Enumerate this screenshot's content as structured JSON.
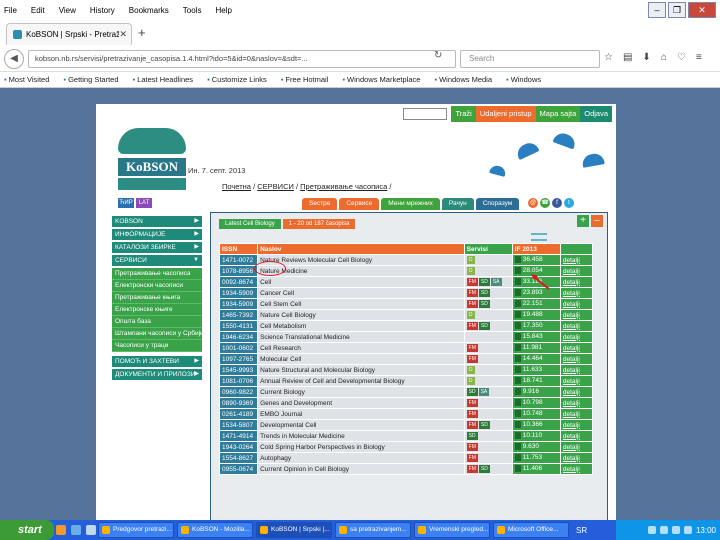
{
  "browser": {
    "menu": [
      "File",
      "Edit",
      "View",
      "History",
      "Bookmarks",
      "Tools",
      "Help"
    ],
    "window_controls": [
      "–",
      "❐",
      "✕"
    ],
    "tab_title": "KoBSON | Srpski - Pretraživanje",
    "url": "kobson.nb.rs/servisi/pretrazivanje_casopisa.1.4.html?ido=5&id=0&naslov=&sdt=...",
    "search_placeholder": "Search",
    "bookmarks": [
      "Most Visited",
      "Getting Started",
      "Latest Headlines",
      "Customize Links",
      "Free Hotmail",
      "Windows Marketplace",
      "Windows Media",
      "Windows"
    ]
  },
  "topnav": {
    "search_btn": "Traži",
    "remote": "Udaljeni pristup",
    "sitemap": "Mapa sajta",
    "logout": "Odjava"
  },
  "logo": {
    "name": "KoBSON"
  },
  "header": {
    "date": "Ин. 7. септ. 2013",
    "crumb_home": "Почетна",
    "crumb_services": "СЕРВИСИ",
    "crumb_current": "Претраживање часописа"
  },
  "langs": [
    "ЋИР",
    "LAT"
  ],
  "sidebar": {
    "items": [
      {
        "label": "KOBSON",
        "arrow": "▶"
      },
      {
        "label": "ИНФОРМАЦИЈЕ",
        "arrow": "▶"
      },
      {
        "label": "КАТАЛОЗИ ЗБИРКЕ",
        "arrow": "▶"
      },
      {
        "label": "СЕРВИСИ",
        "arrow": "▼"
      }
    ],
    "subitems": [
      "Претраживање часописа",
      "Електронски часописи",
      "Претраживање књига",
      "Електронске књиге",
      "Општа база",
      "Штампани часописи у Србији",
      "Часописи у траци"
    ],
    "bottom_items": [
      {
        "label": "ПОМОЋ И ЗАХТЕВИ",
        "arrow": "▶"
      },
      {
        "label": "ДОКУМЕНТИ И ПРИЛОЗИ",
        "arrow": "▶"
      }
    ]
  },
  "service_tabs": [
    "Ѕестре",
    "Сервисе",
    "Мени мрежних",
    "Рачун",
    "Споразум"
  ],
  "social": [
    "@",
    "☎",
    "f",
    "t"
  ],
  "panel": {
    "list_tabs": [
      "Latest Cell Biology",
      "1 - 20 od 187 časopisa"
    ],
    "buttons": [
      "+",
      "–"
    ]
  },
  "table": {
    "headers": [
      "ISSN",
      "Naslov",
      "Servisi",
      "IF 2013",
      ""
    ],
    "rows": [
      {
        "issn": "1471-0072",
        "title": "Nature Reviews Molecular Cell Biology",
        "services": [
          "O"
        ],
        "if": "36.458",
        "detail": "detalji"
      },
      {
        "issn": "1078-8956",
        "title": "Nature Medicine",
        "services": [
          "O"
        ],
        "if": "28.054",
        "detail": "detalji"
      },
      {
        "issn": "0092-8674",
        "title": "Cell",
        "services": [
          "FM",
          "SD",
          "SA"
        ],
        "if": "33.116",
        "detail": "detalji"
      },
      {
        "issn": "1934-5909",
        "title": "Cancer Cell",
        "services": [
          "FM",
          "SD"
        ],
        "if": "23.893",
        "detail": "detalji"
      },
      {
        "issn": "1934-5909",
        "title": "Cell Stem Cell",
        "services": [
          "FM",
          "SD"
        ],
        "if": "22.151",
        "detail": "detalji"
      },
      {
        "issn": "1465-7392",
        "title": "Nature Cell Biology",
        "services": [
          "O"
        ],
        "if": "19.488",
        "detail": "detalji"
      },
      {
        "issn": "1550-4131",
        "title": "Cell Metabolism",
        "services": [
          "FM",
          "SD"
        ],
        "if": "17.350",
        "detail": "detalji"
      },
      {
        "issn": "1946-6234",
        "title": "Science Translational Medicine",
        "services": [],
        "if": "15.843",
        "detail": "detalji"
      },
      {
        "issn": "1001-0602",
        "title": "Cell Research",
        "services": [
          "FM"
        ],
        "if": "11.981",
        "detail": "detalji"
      },
      {
        "issn": "1097-2765",
        "title": "Molecular Cell",
        "services": [
          "FM"
        ],
        "if": "14.464",
        "detail": "detalji"
      },
      {
        "issn": "1545-9993",
        "title": "Nature Structural and Molecular Biology",
        "services": [
          "O"
        ],
        "if": "11.633",
        "detail": "detalji"
      },
      {
        "issn": "1081-0706",
        "title": "Annual Review of Cell and Developmental Biology",
        "services": [
          "O"
        ],
        "if": "18.741",
        "detail": "detalji"
      },
      {
        "issn": "0960-9822",
        "title": "Current Biology",
        "services": [
          "SD",
          "SA"
        ],
        "if": "9.916",
        "detail": "detalji"
      },
      {
        "issn": "0890-9369",
        "title": "Genes and Development",
        "services": [
          "FM"
        ],
        "if": "10.798",
        "detail": "detalji"
      },
      {
        "issn": "0261-4189",
        "title": "EMBO Journal",
        "services": [
          "FM"
        ],
        "if": "10.748",
        "detail": "detalji"
      },
      {
        "issn": "1534-5807",
        "title": "Developmental Cell",
        "services": [
          "FM",
          "SD"
        ],
        "if": "10.366",
        "detail": "detalji"
      },
      {
        "issn": "1471-4914",
        "title": "Trends in Molecular Medicine",
        "services": [
          "SD"
        ],
        "if": "10.110",
        "detail": "detalji"
      },
      {
        "issn": "1943-0264",
        "title": "Cold Spring Harbor Perspectives in Biology",
        "services": [
          "FM"
        ],
        "if": "9.630",
        "detail": "detalji"
      },
      {
        "issn": "1554-8627",
        "title": "Autophagy",
        "services": [
          "FM"
        ],
        "if": "11.753",
        "detail": "detalji"
      },
      {
        "issn": "0955-0674",
        "title": "Current Opinion in Cell Biology",
        "services": [
          "FM",
          "SD"
        ],
        "if": "11.406",
        "detail": "detalji"
      }
    ]
  },
  "taskbar": {
    "start": "start",
    "buttons": [
      "Predgovor pretrazi...",
      "KoBSON - Mozilla...",
      "KoBSON | Srpski |...",
      "sa pretrazivanjem...",
      "Vremenski pregled...",
      "Microsoft Office..."
    ],
    "lang": "SR",
    "clock": "13:00"
  },
  "colors": {
    "accent_green": "#3fa33b",
    "accent_orange": "#ee6b2e",
    "teal": "#1e8a7a",
    "desktop_blue": "#56739c"
  }
}
